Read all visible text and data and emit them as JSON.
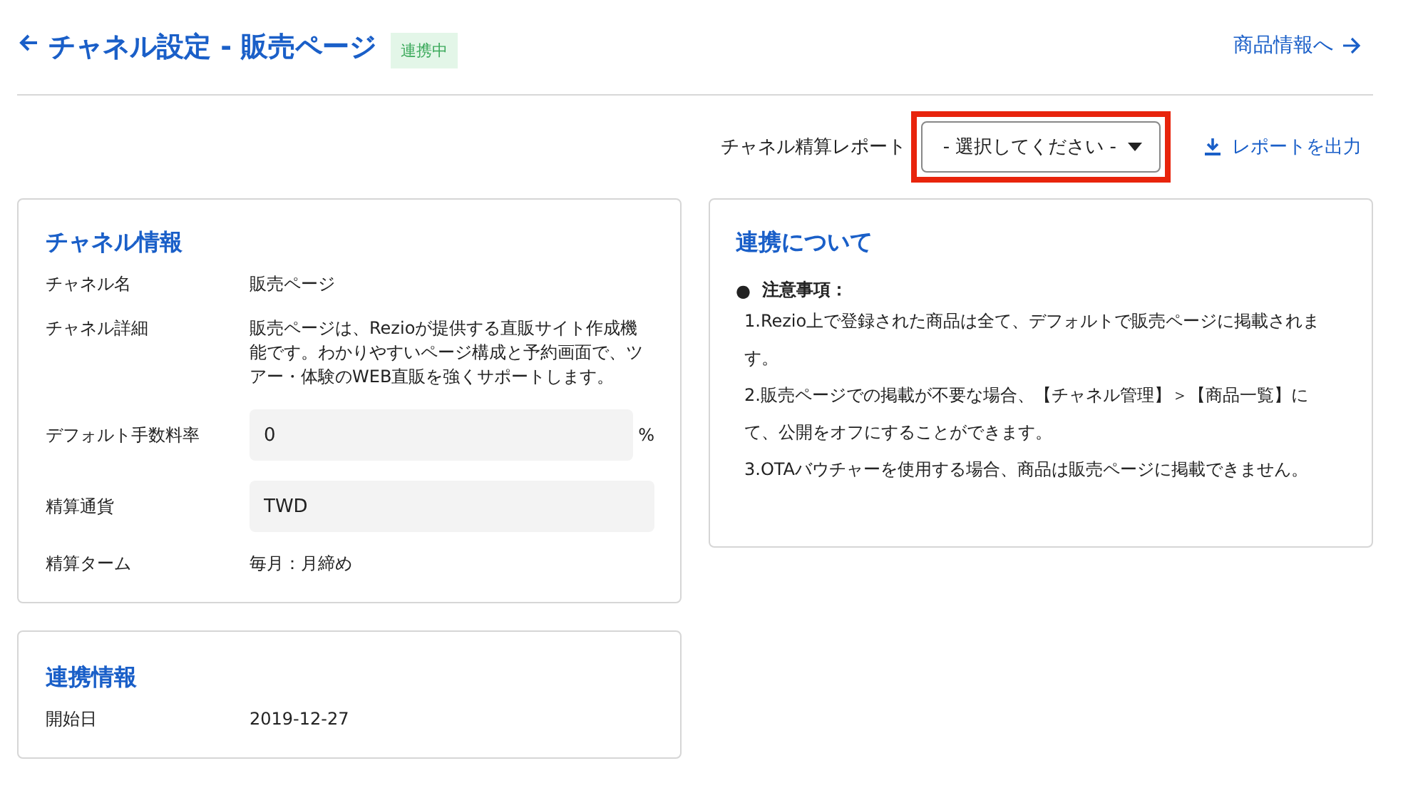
{
  "header": {
    "title": "チャネル設定 - 販売ページ",
    "status_badge": "連携中",
    "link": "商品情報へ"
  },
  "toolbar": {
    "report_label": "チャネル精算レポート",
    "report_select": {
      "value": "- 選択してください -",
      "highlighted": true
    },
    "export_button": "レポートを出力"
  },
  "channel_info": {
    "title": "チャネル情報",
    "rows": [
      {
        "kind": "text",
        "label": "チャネル名",
        "value": "販売ページ"
      },
      {
        "kind": "text",
        "label": "チャネル詳細",
        "value": "販売ページは、Rezioが提供する直販サイト作成機能です。わかりやすいページ構成と予約画面で、ツアー・体験のWEB直販を強くサポートします。"
      },
      {
        "kind": "field",
        "label": "デフォルト手数料率",
        "value": "0",
        "suffix": "%"
      },
      {
        "kind": "field",
        "label": "精算通貨",
        "value": "TWD"
      },
      {
        "kind": "text",
        "label": "精算ターム",
        "value": "毎月：月締め"
      }
    ]
  },
  "link_info": {
    "title": "連携情報",
    "rows": [
      {
        "kind": "text",
        "label": "開始日",
        "value": "2019-12-27"
      }
    ]
  },
  "about": {
    "title": "連携について",
    "bullet": "●",
    "heading": "注意事項：",
    "notes": [
      "1.Rezio上で登録された商品は全て、デフォルトで販売ページに掲載されます。",
      "2.販売ページでの掲載が不要な場合、【チャネル管理】＞【商品一覧】にて、公開をオフにすることができます。",
      "3.OTAバウチャーを使用する場合、商品は販売ページに掲載できません。"
    ]
  }
}
